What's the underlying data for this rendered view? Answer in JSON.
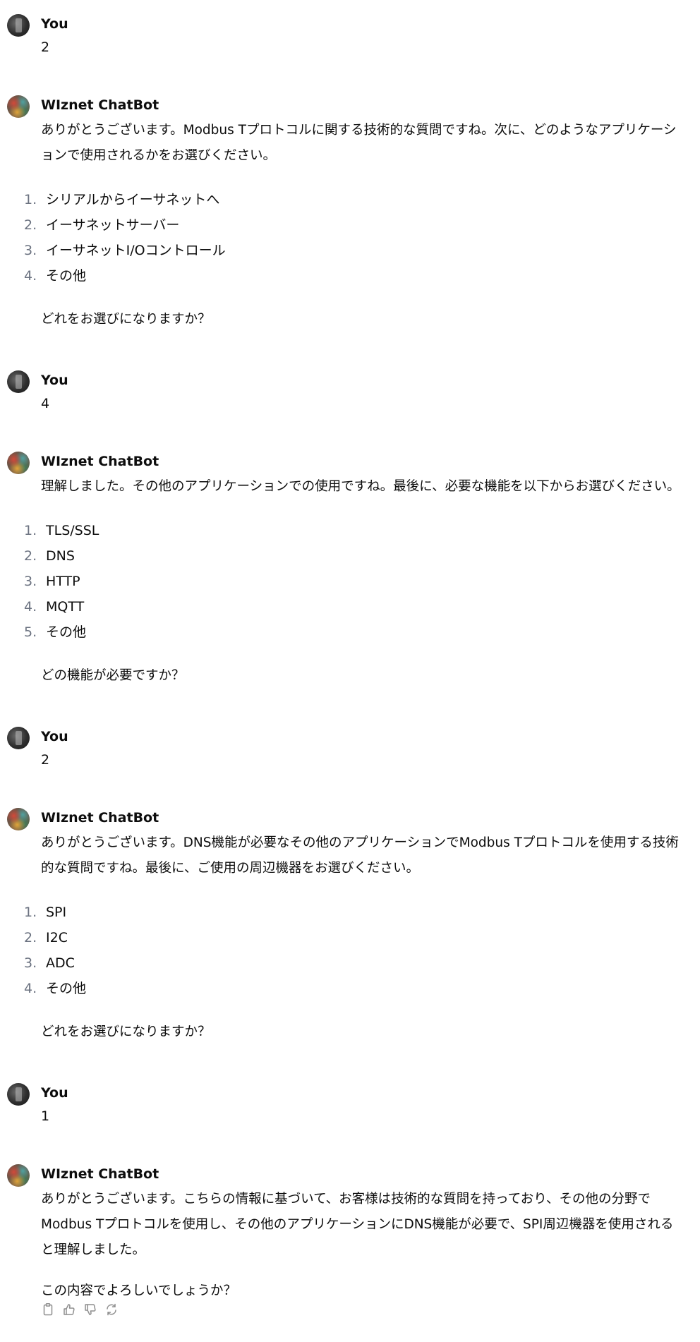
{
  "messages": [
    {
      "sender": "You",
      "text": "2"
    },
    {
      "sender": "WIznet ChatBot",
      "intro": "ありがとうございます。Modbus Tプロトコルに関する技術的な質問ですね。次に、どのようなアプリケーションで使用されるかをお選びください。",
      "options": [
        {
          "num": "1.",
          "label": "シリアルからイーサネットへ"
        },
        {
          "num": "2.",
          "label": "イーサネットサーバー"
        },
        {
          "num": "3.",
          "label": "イーサネットI/Oコントロール"
        },
        {
          "num": "4.",
          "label": "その他"
        }
      ],
      "question": "どれをお選びになりますか？"
    },
    {
      "sender": "You",
      "text": "4"
    },
    {
      "sender": "WIznet ChatBot",
      "intro": "理解しました。その他のアプリケーションでの使用ですね。最後に、必要な機能を以下からお選びください。",
      "options": [
        {
          "num": "1.",
          "label": "TLS/SSL"
        },
        {
          "num": "2.",
          "label": "DNS"
        },
        {
          "num": "3.",
          "label": "HTTP"
        },
        {
          "num": "4.",
          "label": "MQTT"
        },
        {
          "num": "5.",
          "label": "その他"
        }
      ],
      "question": "どの機能が必要ですか？"
    },
    {
      "sender": "You",
      "text": "2"
    },
    {
      "sender": "WIznet ChatBot",
      "intro": "ありがとうございます。DNS機能が必要なその他のアプリケーションでModbus Tプロトコルを使用する技術的な質問ですね。最後に、ご使用の周辺機器をお選びください。",
      "options": [
        {
          "num": "1.",
          "label": "SPI"
        },
        {
          "num": "2.",
          "label": "I2C"
        },
        {
          "num": "3.",
          "label": "ADC"
        },
        {
          "num": "4.",
          "label": "その他"
        }
      ],
      "question": "どれをお選びになりますか？"
    },
    {
      "sender": "You",
      "text": "1"
    },
    {
      "sender": "WIznet ChatBot",
      "intro": "ありがとうございます。こちらの情報に基づいて、お客様は技術的な質問を持っており、その他の分野でModbus Tプロトコルを使用し、その他のアプリケーションにDNS機能が必要で、SPI周辺機器を使用されると理解しました。",
      "question": "この内容でよろしいでしょうか？"
    }
  ],
  "actions": {
    "icons": [
      "copy-icon",
      "thumbs-up-icon",
      "thumbs-down-icon",
      "regenerate-icon"
    ],
    "icon_color": "#8e8e8e"
  }
}
